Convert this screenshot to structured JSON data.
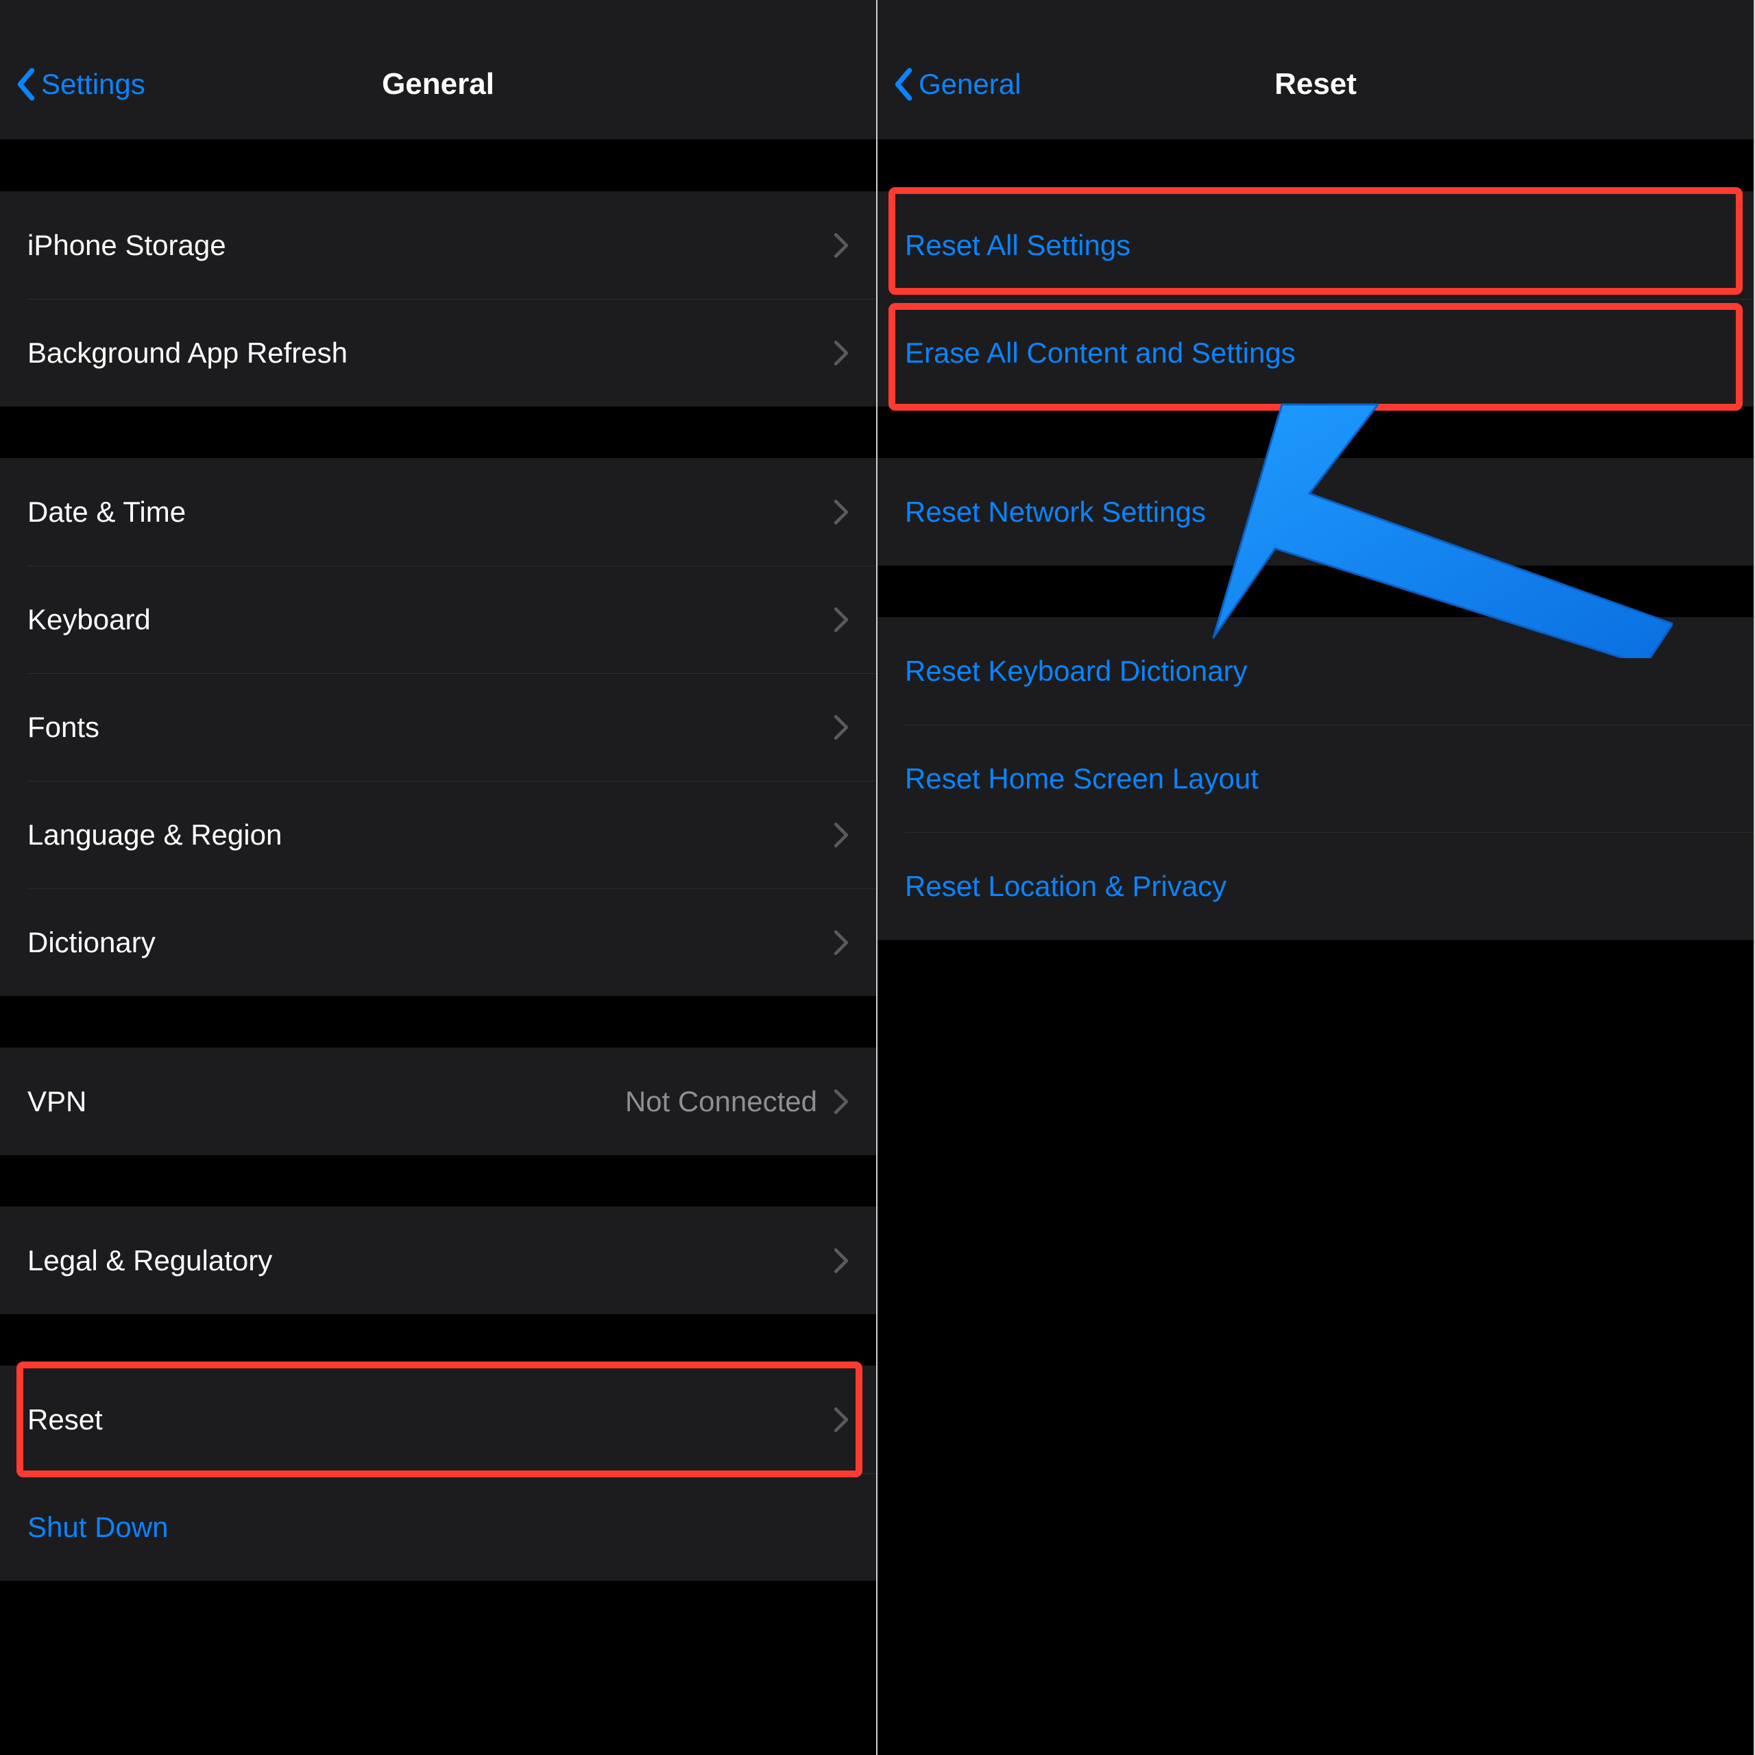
{
  "left": {
    "backLabel": "Settings",
    "title": "General",
    "groups": [
      [
        {
          "label": "iPhone Storage",
          "chevron": true
        },
        {
          "label": "Background App Refresh",
          "chevron": true
        }
      ],
      [
        {
          "label": "Date & Time",
          "chevron": true
        },
        {
          "label": "Keyboard",
          "chevron": true
        },
        {
          "label": "Fonts",
          "chevron": true
        },
        {
          "label": "Language & Region",
          "chevron": true
        },
        {
          "label": "Dictionary",
          "chevron": true
        }
      ],
      [
        {
          "label": "VPN",
          "detail": "Not Connected",
          "chevron": true
        }
      ],
      [
        {
          "label": "Legal & Regulatory",
          "chevron": true
        }
      ],
      [
        {
          "label": "Reset",
          "chevron": true,
          "highlight": true
        },
        {
          "label": "Shut Down",
          "blue": true
        }
      ]
    ]
  },
  "right": {
    "backLabel": "General",
    "title": "Reset",
    "groups": [
      [
        {
          "label": "Reset All Settings",
          "blue": true,
          "highlight": true
        },
        {
          "label": "Erase All Content and Settings",
          "blue": true,
          "highlight": true
        }
      ],
      [
        {
          "label": "Reset Network Settings",
          "blue": true
        }
      ],
      [
        {
          "label": "Reset Keyboard Dictionary",
          "blue": true
        },
        {
          "label": "Reset Home Screen Layout",
          "blue": true
        },
        {
          "label": "Reset Location & Privacy",
          "blue": true
        }
      ]
    ]
  }
}
